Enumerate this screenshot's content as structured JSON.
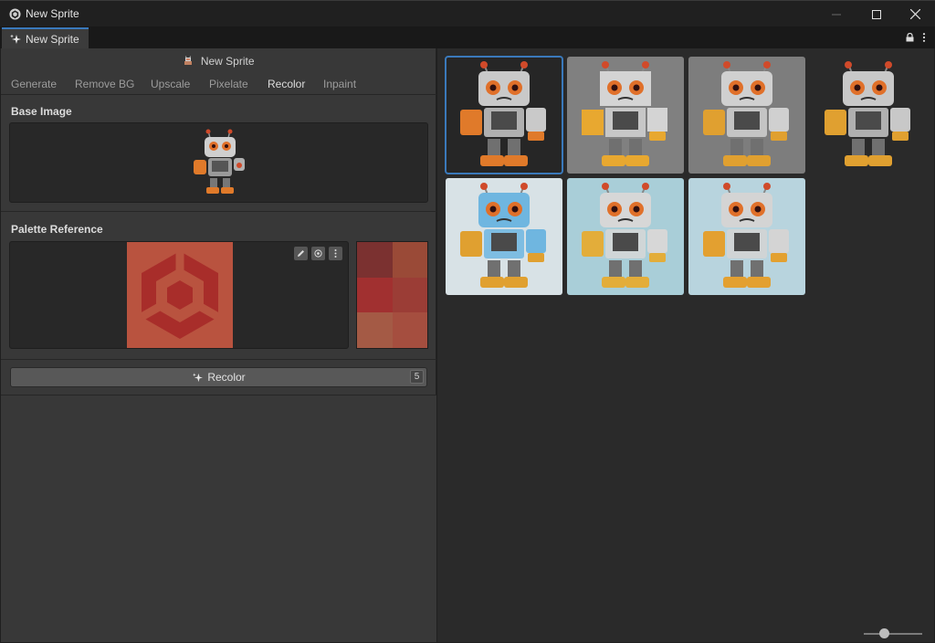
{
  "window": {
    "title": "New Sprite"
  },
  "tab": {
    "label": "New Sprite"
  },
  "header": {
    "title": "New Sprite"
  },
  "modes": [
    {
      "label": "Generate"
    },
    {
      "label": "Remove BG"
    },
    {
      "label": "Upscale"
    },
    {
      "label": "Pixelate"
    },
    {
      "label": "Recolor"
    },
    {
      "label": "Inpaint"
    }
  ],
  "active_mode": "Recolor",
  "base_image": {
    "label": "Base Image"
  },
  "palette": {
    "label": "Palette Reference",
    "swatches": [
      "#7b3130",
      "#9a4a37",
      "#a13030",
      "#9b3d36",
      "#a45a45",
      "#a54e3f"
    ]
  },
  "recolor_button": {
    "label": "Recolor",
    "count": "5"
  },
  "results": [
    {
      "bg": "#262626",
      "body": "#c9c9c9",
      "accent": "#e07a2a",
      "selected": true
    },
    {
      "bg": "#808080",
      "body": "#d4d4d4",
      "accent": "#e8a830",
      "pixelated": true
    },
    {
      "bg": "#7d7d7d",
      "body": "#d0d0d0",
      "accent": "#e0a030"
    },
    {
      "bg": "#2a2a2a",
      "body": "#c8c8c8",
      "accent": "#e0a030"
    },
    {
      "bg": "#d8e2e6",
      "body": "#6fb6e0",
      "accent": "#e0a030"
    },
    {
      "bg": "#a9ced8",
      "body": "#d7d7d7",
      "accent": "#e3ad3a"
    },
    {
      "bg": "#b8d4de",
      "body": "#d4d4d4",
      "accent": "#e3a030"
    }
  ],
  "zoom": {
    "value": 0.35
  }
}
